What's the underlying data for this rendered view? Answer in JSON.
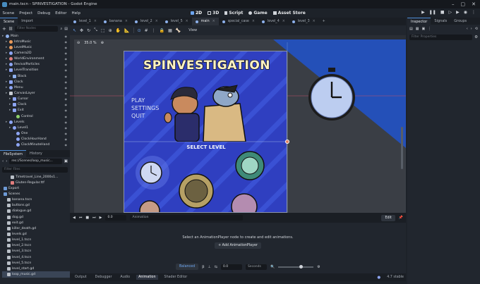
{
  "window": {
    "title": "main.tscn - SPINVESTIGATION - Godot Engine"
  },
  "menu": [
    "Scene",
    "Project",
    "Debug",
    "Editor",
    "Help"
  ],
  "workspaces": [
    {
      "label": "2D",
      "active": true
    },
    {
      "label": "3D"
    },
    {
      "label": "Script"
    },
    {
      "label": "Game"
    },
    {
      "label": "Asset Store"
    }
  ],
  "scene_dock": {
    "tabs": [
      "Scene",
      "Import"
    ],
    "filter_placeholder": "Filter Nodes",
    "nodes": [
      {
        "label": "Main",
        "depth": 0,
        "color": "#8eb1ec",
        "shape": "dot"
      },
      {
        "label": "IntroMusic",
        "depth": 1,
        "color": "#ea9a5a",
        "shape": "dot"
      },
      {
        "label": "LevelMusic",
        "depth": 1,
        "color": "#ea9a5a",
        "shape": "dot"
      },
      {
        "label": "Camera2D",
        "depth": 1,
        "color": "#8da5f3",
        "shape": "dot"
      },
      {
        "label": "WorldEnvironment",
        "depth": 1,
        "color": "#e07d7d",
        "shape": "dot"
      },
      {
        "label": "RevivalParticles",
        "depth": 1,
        "color": "#8da5f3",
        "shape": "dot"
      },
      {
        "label": "LevelTransition",
        "depth": 1,
        "color": "#8da5f3",
        "shape": "sq"
      },
      {
        "label": "Black",
        "depth": 2,
        "color": "#8eb1ec",
        "shape": "sq"
      },
      {
        "label": "Clock",
        "depth": 1,
        "color": "#8da5f3",
        "shape": "sq"
      },
      {
        "label": "Menu",
        "depth": 1,
        "color": "#8da5f3",
        "shape": "dot"
      },
      {
        "label": "CanvasLayer",
        "depth": 1,
        "color": "#c8ccd2",
        "shape": "sq"
      },
      {
        "label": "Cursor",
        "depth": 2,
        "color": "#8da5f3",
        "shape": "sq"
      },
      {
        "label": "Clock",
        "depth": 2,
        "color": "#8da5f3",
        "shape": "sq"
      },
      {
        "label": "Exit",
        "depth": 2,
        "color": "#8da5f3",
        "shape": "sq"
      },
      {
        "label": "Control",
        "depth": 3,
        "color": "#8ed16a",
        "shape": "dot"
      },
      {
        "label": "Levels",
        "depth": 1,
        "color": "#8da5f3",
        "shape": "dot"
      },
      {
        "label": "Level1",
        "depth": 2,
        "color": "#8da5f3",
        "shape": "dot"
      },
      {
        "label": "One",
        "depth": 3,
        "color": "#8da5f3",
        "shape": "dot"
      },
      {
        "label": "ClockHourHand",
        "depth": 3,
        "color": "#8da5f3",
        "shape": "dot"
      },
      {
        "label": "ClockMinuteHand",
        "depth": 3,
        "color": "#8da5f3",
        "shape": "dot"
      }
    ]
  },
  "filesystem": {
    "tabs": [
      "FileSystem",
      "History"
    ],
    "path": "res://Scenes/loop_music...",
    "filter_placeholder": "Filter Files",
    "items": [
      {
        "label": "Timetravel_Line_2000x1...",
        "depth": 2,
        "kind": "file"
      },
      {
        "label": "Gluten-Regular.ttf",
        "depth": 2,
        "kind": "font"
      },
      {
        "label": "Export",
        "depth": 0,
        "kind": "folder"
      },
      {
        "label": "Scenes",
        "depth": 0,
        "kind": "folder"
      },
      {
        "label": "banana.tscn",
        "depth": 1,
        "kind": "file"
      },
      {
        "label": "buttons.gd",
        "depth": 1,
        "kind": "file"
      },
      {
        "label": "dialogue.gd",
        "depth": 1,
        "kind": "file"
      },
      {
        "label": "dog.gd",
        "depth": 1,
        "kind": "file"
      },
      {
        "label": "exit.gd",
        "depth": 1,
        "kind": "file"
      },
      {
        "label": "killer_death.gd",
        "depth": 1,
        "kind": "file"
      },
      {
        "label": "levels.gd",
        "depth": 1,
        "kind": "file"
      },
      {
        "label": "level_1.tscn",
        "depth": 1,
        "kind": "file"
      },
      {
        "label": "level_2.tscn",
        "depth": 1,
        "kind": "file"
      },
      {
        "label": "level_3.tscn",
        "depth": 1,
        "kind": "file"
      },
      {
        "label": "level_4.tscn",
        "depth": 1,
        "kind": "file"
      },
      {
        "label": "level_5.tscn",
        "depth": 1,
        "kind": "file"
      },
      {
        "label": "level_start.gd",
        "depth": 1,
        "kind": "file"
      },
      {
        "label": "loop_music.gd",
        "depth": 1,
        "kind": "file",
        "selected": true
      }
    ]
  },
  "editor_tabs": [
    {
      "label": "level_1"
    },
    {
      "label": "banana"
    },
    {
      "label": "level_2"
    },
    {
      "label": "level_5"
    },
    {
      "label": "main",
      "active": true
    },
    {
      "label": "special_case"
    },
    {
      "label": "level_4"
    },
    {
      "label": "level_3"
    },
    {
      "label": "+"
    }
  ],
  "toolbar": {
    "view_label": "View"
  },
  "viewport": {
    "zoom": "35.0 %"
  },
  "game": {
    "title": "SPINVESTIGATION",
    "menu": [
      "PLAY",
      "SETTINGS",
      "QUIT"
    ],
    "select_level": "SELECT LEVEL"
  },
  "animation": {
    "time": "0.0",
    "name": "Animation",
    "edit": "Edit",
    "hint": "Select an AnimationPlayer node to create and edit animations.",
    "add_button": "+ Add AnimationPlayer",
    "mode": "Balanced",
    "snap": "0.0",
    "unit": "Seconds",
    "fps": "4.7 stable"
  },
  "bottom_tabs": [
    "Output",
    "Debugger",
    "Audio",
    "Animation",
    "Shader Editor"
  ],
  "inspector": {
    "tabs": [
      "Inspector",
      "Signals",
      "Groups"
    ],
    "filter_placeholder": "Filter Properties"
  }
}
